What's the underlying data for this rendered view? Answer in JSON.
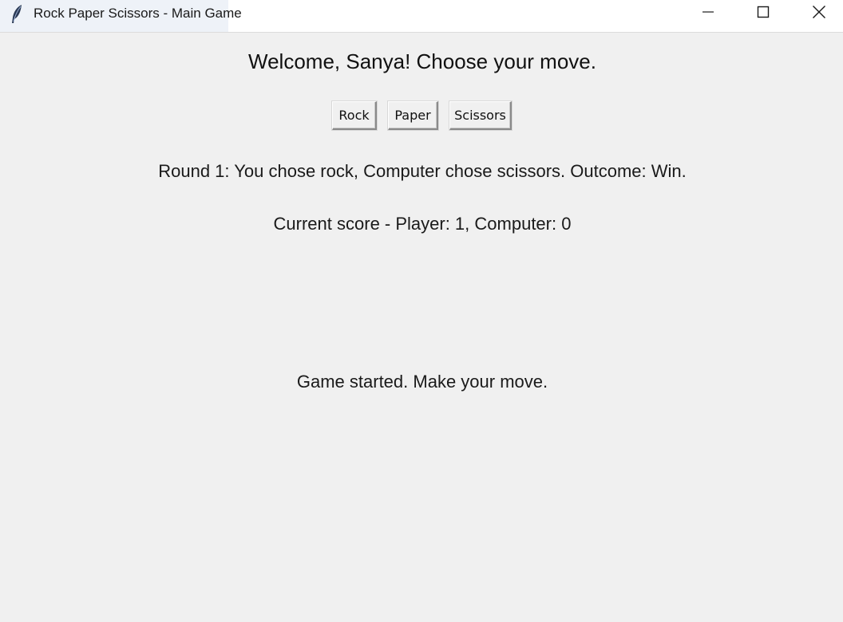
{
  "window": {
    "title": "Rock Paper Scissors - Main Game",
    "icon": "feather-icon",
    "controls": [
      "minimize-icon",
      "maximize-icon",
      "close-icon"
    ]
  },
  "game": {
    "welcome": "Welcome, Sanya! Choose your move.",
    "buttons": {
      "rock": "Rock",
      "paper": "Paper",
      "scissors": "Scissors"
    },
    "round_result": "Round 1: You chose rock, Computer chose scissors. Outcome: Win.",
    "score": "Current score - Player: 1, Computer: 0",
    "status": "Game started. Make your move."
  },
  "colors": {
    "background": "#f0f0f0",
    "titlebar": "#ffffff",
    "text": "#1a1a1a"
  }
}
